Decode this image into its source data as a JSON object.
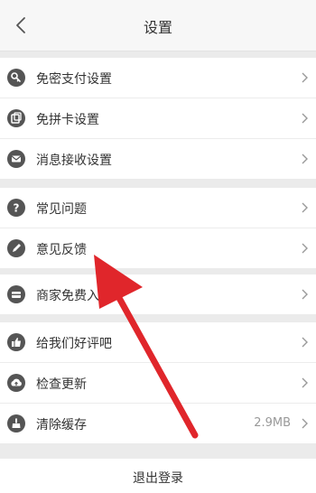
{
  "header": {
    "title": "设置",
    "back_icon": "chevron-left-icon"
  },
  "groups": [
    {
      "items": [
        {
          "label": "免密支付设置",
          "icon": "key-icon"
        },
        {
          "label": "免拼卡设置",
          "icon": "card-icon"
        },
        {
          "label": "消息接收设置",
          "icon": "envelope-icon"
        }
      ]
    },
    {
      "items": [
        {
          "label": "常见问题",
          "icon": "question-icon"
        },
        {
          "label": "意见反馈",
          "icon": "pencil-icon"
        }
      ]
    },
    {
      "items": [
        {
          "label": "商家免费入",
          "icon": "store-icon"
        }
      ]
    },
    {
      "items": [
        {
          "label": "给我们好评吧",
          "icon": "thumbs-up-icon"
        },
        {
          "label": "检查更新",
          "icon": "cloud-upload-icon"
        },
        {
          "label": "清除缓存",
          "icon": "broom-icon",
          "value": "2.9MB"
        }
      ]
    }
  ],
  "logout": {
    "label": "退出登录"
  },
  "annotation": {
    "icon": "red-arrow-icon",
    "color": "#e0262b"
  }
}
